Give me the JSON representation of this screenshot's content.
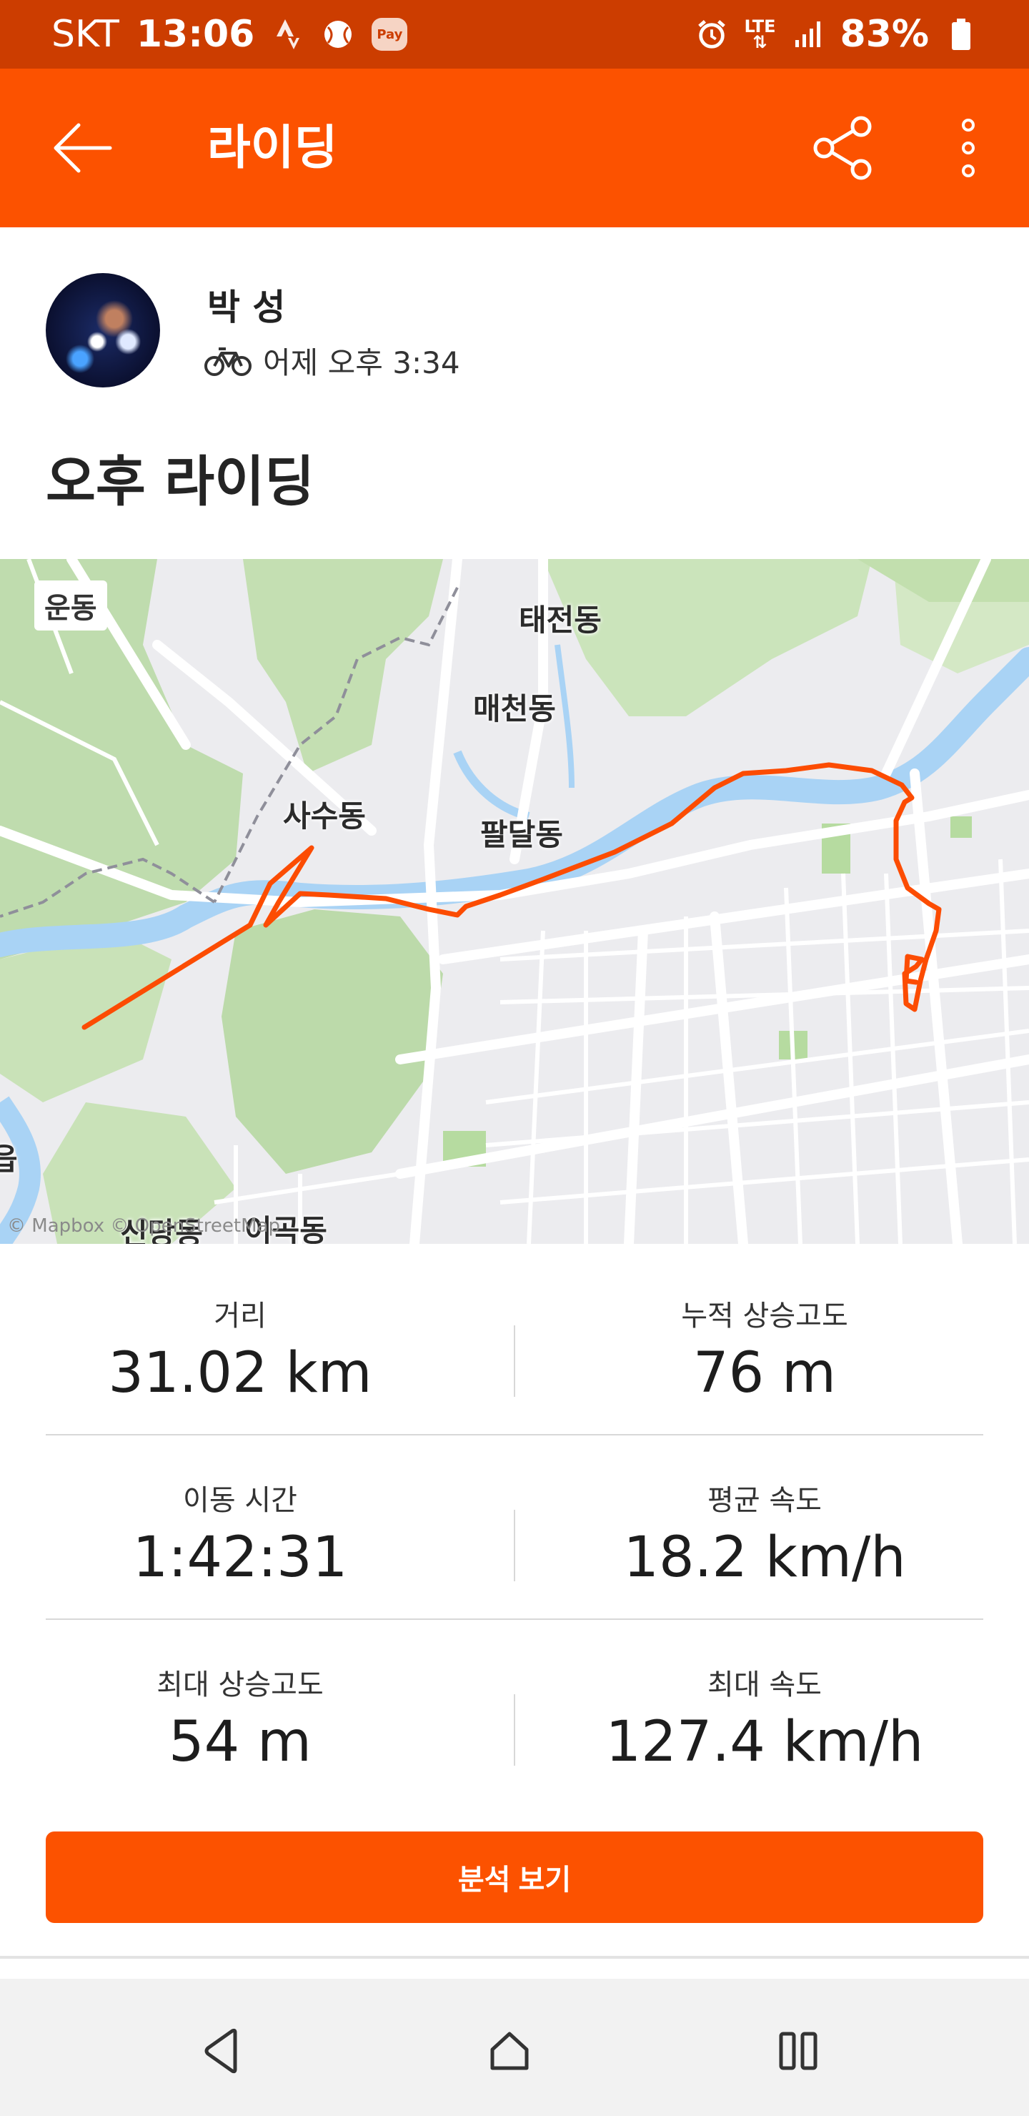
{
  "status_bar": {
    "carrier": "SKT",
    "time": "13:06",
    "pay_label": "Pay",
    "network": "LTE",
    "battery": "83%"
  },
  "app_bar": {
    "title": "라이딩",
    "back_icon": "arrow-left-icon",
    "share_icon": "share-icon",
    "more_icon": "more-vertical-icon"
  },
  "athlete": {
    "name": "박 성",
    "activity_icon": "bicycle-icon",
    "time": "어제 오후 3:34"
  },
  "activity_title": "오후 라이딩",
  "map": {
    "tag": "운동",
    "places": [
      "태전동",
      "매천동",
      "사수동",
      "팔달동",
      "신당동",
      "이곡동",
      "읍"
    ],
    "attribution": "© Mapbox © OpenStreetMap"
  },
  "stats": {
    "distance_label": "거리",
    "distance_value": "31.02 km",
    "elev_gain_label": "누적 상승고도",
    "elev_gain_value": "76 m",
    "moving_time_label": "이동 시간",
    "moving_time_value": "1:42:31",
    "avg_speed_label": "평균 속도",
    "avg_speed_value": "18.2 km/h",
    "max_elev_label": "최대 상승고도",
    "max_elev_value": "54 m",
    "max_speed_label": "최대 속도",
    "max_speed_value": "127.4 km/h"
  },
  "analyze_button": "분석 보기",
  "colors": {
    "brand": "#fc5200",
    "status_bar": "#cc3d00",
    "route": "#fc4c02",
    "river": "#a9d3f5"
  },
  "nav": {
    "back": "nav-back-icon",
    "home": "nav-home-icon",
    "recents": "nav-recents-icon"
  }
}
